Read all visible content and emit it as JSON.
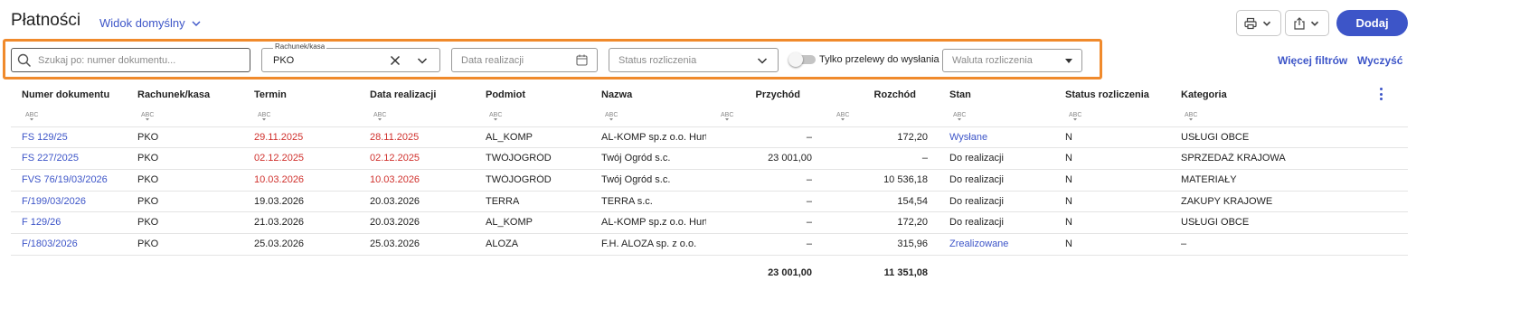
{
  "header": {
    "title": "Płatności",
    "view": "Widok domyślny",
    "add_label": "Dodaj"
  },
  "filters": {
    "search_placeholder": "Szukaj po: numer dokumentu...",
    "account_label": "Rachunek/kasa",
    "account_value": "PKO",
    "date_placeholder": "Data realizacji",
    "status_placeholder": "Status rozliczenia",
    "transfer_toggle_label": "Tylko przelewy do wysłania",
    "currency_placeholder": "Waluta rozliczenia",
    "more_filters": "Więcej filtrów",
    "clear": "Wyczyść"
  },
  "table": {
    "columns": [
      "Numer dokumentu",
      "Rachunek/kasa",
      "Termin",
      "Data realizacji",
      "Podmiot",
      "Nazwa",
      "Przychód",
      "Rozchód",
      "Stan",
      "Status rozliczenia",
      "Kategoria"
    ],
    "rows": [
      [
        "FS 129/25",
        "PKO",
        "29.11.2025",
        "28.11.2025",
        "AL_KOMP",
        "AL-KOMP sp.z o.o. Hurtow",
        "–",
        "172,20",
        "Wysłane",
        "N",
        "USŁUGI OBCE"
      ],
      [
        "FS 227/2025",
        "PKO",
        "02.12.2025",
        "02.12.2025",
        "TWÓJOGRÓD",
        "Twój Ogród s.c.",
        "23 001,00",
        "–",
        "Do realizacji",
        "N",
        "SPRZEDAŻ KRAJOWA"
      ],
      [
        "FVS 76/19/03/2026",
        "PKO",
        "10.03.2026",
        "10.03.2026",
        "TWÓJOGRÓD",
        "Twój Ogród s.c.",
        "–",
        "10 536,18",
        "Do realizacji",
        "N",
        "MATERIAŁY"
      ],
      [
        "F/199/03/2026",
        "PKO",
        "19.03.2026",
        "20.03.2026",
        "TERRA",
        "TERRA s.c.",
        "–",
        "154,54",
        "Do realizacji",
        "N",
        "ZAKUPY KRAJOWE"
      ],
      [
        "F 129/26",
        "PKO",
        "21.03.2026",
        "20.03.2026",
        "AL_KOMP",
        "AL-KOMP sp.z o.o. Hurtow",
        "–",
        "172,20",
        "Do realizacji",
        "N",
        "USŁUGI OBCE"
      ],
      [
        "F/1803/2026",
        "PKO",
        "25.03.2026",
        "25.03.2026",
        "ALOZA",
        "F.H. ALOZA sp. z o.o.",
        "–",
        "315,96",
        "Zrealizowane",
        "N",
        "–"
      ]
    ],
    "totals": {
      "income": "23 001,00",
      "expense": "11 351,08"
    }
  },
  "colors": {
    "accent": "#3d55c8",
    "overdue": "#d0312d",
    "highlight_frame": "#f08a2c"
  }
}
